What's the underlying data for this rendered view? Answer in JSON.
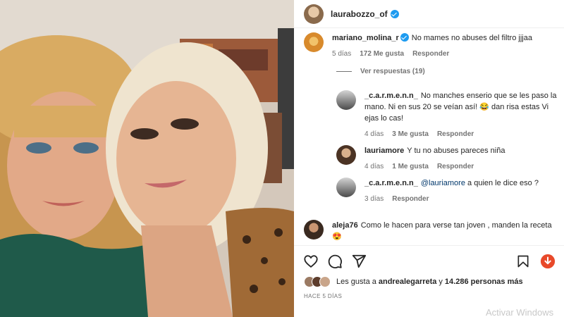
{
  "post": {
    "username": "laurabozzo_of"
  },
  "comments": [
    {
      "username": "mariano_molina_r",
      "text": "No mames no abuses del filtro jjjaa",
      "time": "5 días",
      "likes": "172 Me gusta",
      "reply_label": "Responder"
    }
  ],
  "view_replies": "Ver respuestas (19)",
  "replies": [
    {
      "username": "_c.a.r.m.e.n.n_",
      "line1": "No manches enserio que se les paso la",
      "line2": "mano. Ni en sus 20 se veían así! 😂 dan risa estas Vi",
      "line3": "ejas lo cas!",
      "time": "4 días",
      "likes": "3 Me gusta",
      "reply_label": "Responder"
    },
    {
      "username": "lauriamore",
      "text": "Y tu no abuses pareces niña",
      "time": "4 días",
      "likes": "1 Me gusta",
      "reply_label": "Responder"
    },
    {
      "username": "_c.a.r.m.e.n.n_",
      "mention": "@lauriamore",
      "text": "a quien le dice eso ?",
      "time": "3 días",
      "reply_label": "Responder"
    }
  ],
  "last_comment": {
    "username": "aleja76",
    "text": "Como le hacen para verse tan joven , manden la receta",
    "emoji": "😍"
  },
  "likes": {
    "prefix": "Les gusta a",
    "user": "andrealegarreta",
    "conj": "y",
    "count": "14.286 personas más"
  },
  "time_ago": "HACE 5 DÍAS",
  "watermark": "Activar Windows",
  "icons": [
    "heart-icon",
    "comment-icon",
    "share-icon",
    "bookmark-icon",
    "download-icon",
    "verified-icon"
  ],
  "colors": {
    "verified": "#1d9bf0",
    "download": "#e8492a",
    "mention": "#00376b"
  }
}
